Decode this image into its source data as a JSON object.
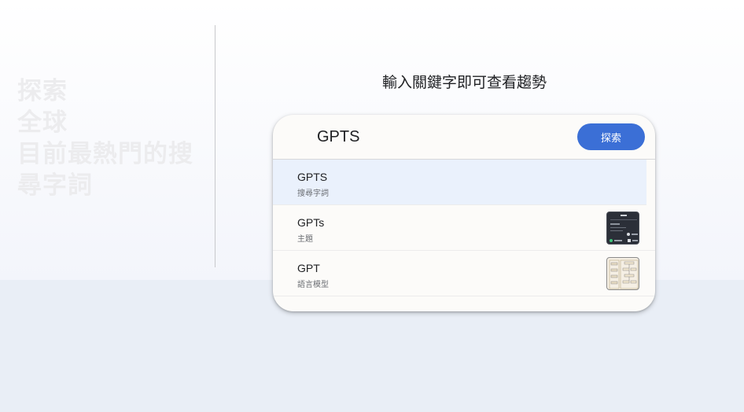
{
  "hero": {
    "lines": [
      "探索",
      "全球",
      "目前最熱門的搜",
      "尋字詞"
    ]
  },
  "prompt": "輸入關鍵字即可查看趨勢",
  "search": {
    "value": "GPTS",
    "button_label": "探索"
  },
  "suggestions": [
    {
      "title": "GPTS",
      "subtitle": "搜尋字詞"
    },
    {
      "title": "GPTs",
      "subtitle": "主題"
    },
    {
      "title": "GPT",
      "subtitle": "語言模型"
    }
  ],
  "colors": {
    "accent": "#3b6fd6",
    "selected_row": "#eaf1fc",
    "hero_text": "#ececee"
  }
}
